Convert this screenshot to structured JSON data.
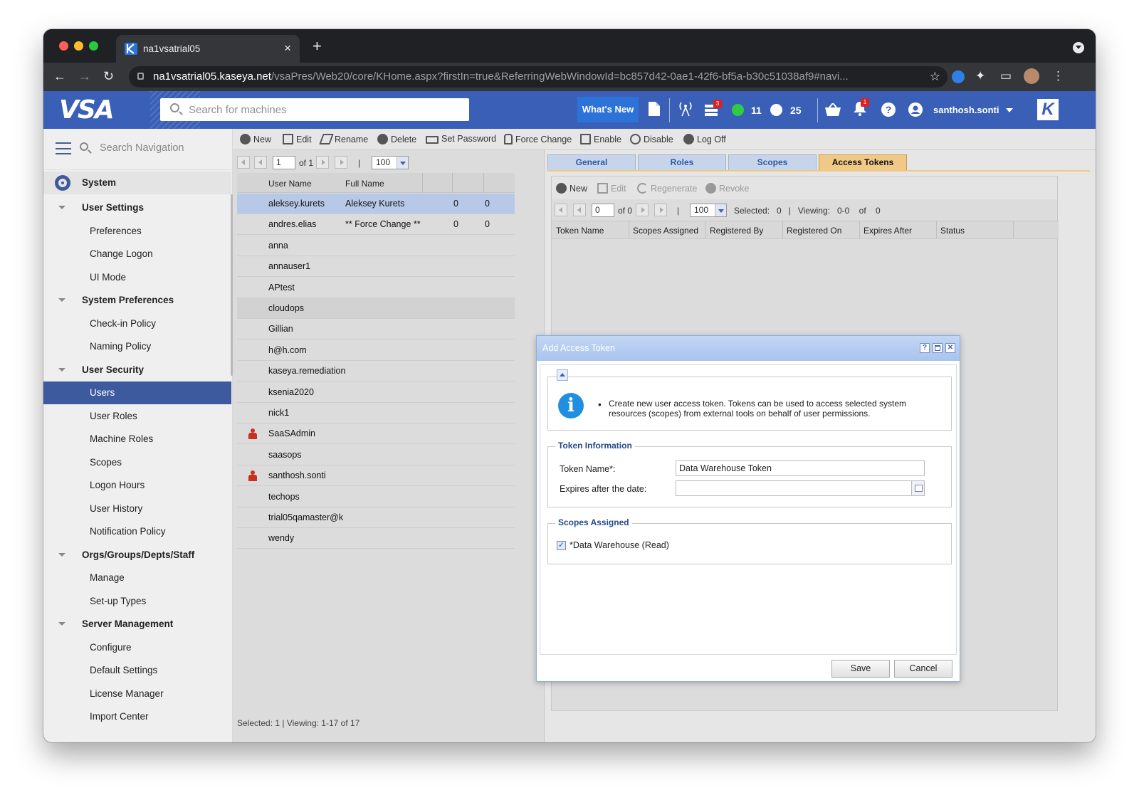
{
  "browser": {
    "tab_title": "na1vsatrial05",
    "new_tab_symbol": "+",
    "close_symbol": "×",
    "url_domain": "na1vsatrial05.kaseya.net",
    "url_path": "/vsaPres/Web20/core/KHome.aspx?firstIn=true&ReferringWebWindowId=bc857d42-0ae1-42f6-bf5a-b30c51038af9#navi..."
  },
  "header": {
    "logo": "VSA",
    "search_placeholder": "Search for machines",
    "whats_new": "What's New",
    "alerts_badge": "3",
    "online_count": "11",
    "offline_count": "25",
    "notif_badge": "1",
    "user": "santhosh.sonti",
    "brand_k": "K",
    "colors": {
      "header": "#3a5fb6",
      "online": "#2ecc40",
      "offline": "#ffffff"
    }
  },
  "sidebar": {
    "search_placeholder": "Search Navigation",
    "system": "System",
    "items": [
      {
        "label": "User Settings",
        "type": "grp"
      },
      {
        "label": "Preferences",
        "type": "item"
      },
      {
        "label": "Change Logon",
        "type": "item"
      },
      {
        "label": "UI Mode",
        "type": "item"
      },
      {
        "label": "System Preferences",
        "type": "grp"
      },
      {
        "label": "Check-in Policy",
        "type": "item"
      },
      {
        "label": "Naming Policy",
        "type": "item"
      },
      {
        "label": "User Security",
        "type": "grp"
      },
      {
        "label": "Users",
        "type": "sel"
      },
      {
        "label": "User Roles",
        "type": "item"
      },
      {
        "label": "Machine Roles",
        "type": "item"
      },
      {
        "label": "Scopes",
        "type": "item"
      },
      {
        "label": "Logon Hours",
        "type": "item"
      },
      {
        "label": "User History",
        "type": "item"
      },
      {
        "label": "Notification Policy",
        "type": "item"
      },
      {
        "label": "Orgs/Groups/Depts/Staff",
        "type": "grp"
      },
      {
        "label": "Manage",
        "type": "item"
      },
      {
        "label": "Set-up Types",
        "type": "item"
      },
      {
        "label": "Server Management",
        "type": "grp"
      },
      {
        "label": "Configure",
        "type": "item"
      },
      {
        "label": "Default Settings",
        "type": "item"
      },
      {
        "label": "License Manager",
        "type": "item"
      },
      {
        "label": "Import Center",
        "type": "item"
      }
    ]
  },
  "toolbar": {
    "new": "New",
    "edit": "Edit",
    "rename": "Rename",
    "delete": "Delete",
    "set_password": "Set Password",
    "force_change": "Force Change",
    "enable": "Enable",
    "disable": "Disable",
    "log_off": "Log Off"
  },
  "users_pager": {
    "page": "1",
    "of": "of 1",
    "sep": "|",
    "page_size": "100"
  },
  "users_grid": {
    "col_user": "User Name",
    "col_full": "Full Name",
    "rows": [
      {
        "user": "aleksey.kurets",
        "full": "Aleksey Kurets",
        "a": "0",
        "b": "0",
        "sel": true
      },
      {
        "user": "andres.elias",
        "full": "** Force Change **",
        "a": "0",
        "b": "0"
      },
      {
        "user": "anna",
        "full": "",
        "a": "",
        "b": ""
      },
      {
        "user": "annauser1",
        "full": "",
        "a": "",
        "b": ""
      },
      {
        "user": "APtest",
        "full": "",
        "a": "",
        "b": ""
      },
      {
        "user": "cloudops",
        "full": "",
        "a": "",
        "b": "",
        "alt": true
      },
      {
        "user": "Gillian",
        "full": "",
        "a": "",
        "b": ""
      },
      {
        "user": "h@h.com",
        "full": "",
        "a": "",
        "b": ""
      },
      {
        "user": "kaseya.remediation",
        "full": "",
        "a": "",
        "b": ""
      },
      {
        "user": "ksenia2020",
        "full": "",
        "a": "",
        "b": ""
      },
      {
        "user": "nick1",
        "full": "",
        "a": "",
        "b": ""
      },
      {
        "user": "SaaSAdmin",
        "full": "",
        "a": "",
        "b": "",
        "icon": true
      },
      {
        "user": "saasops",
        "full": "",
        "a": "",
        "b": ""
      },
      {
        "user": "santhosh.sonti",
        "full": "",
        "a": "",
        "b": "",
        "icon": true
      },
      {
        "user": "techops",
        "full": "",
        "a": "",
        "b": ""
      },
      {
        "user": "trial05qamaster@k",
        "full": "",
        "a": "",
        "b": ""
      },
      {
        "user": "wendy",
        "full": "",
        "a": "",
        "b": ""
      }
    ],
    "status": "Selected:   1   |   Viewing:   1-17    of    17"
  },
  "detail_tabs": [
    "General",
    "Roles",
    "Scopes",
    "Access Tokens"
  ],
  "tokens_toolbar": {
    "new": "New",
    "edit": "Edit",
    "regenerate": "Regenerate",
    "revoke": "Revoke"
  },
  "tokens_pager": {
    "page": "0",
    "of": "of 0",
    "sep": "|",
    "page_size": "100",
    "status": "Selected:   0   |   Viewing:   0-0    of    0"
  },
  "tokens_grid": {
    "cols": [
      "Token Name",
      "Scopes Assigned",
      "Registered By",
      "Registered On",
      "Expires After",
      "Status"
    ]
  },
  "modal": {
    "title": "Add Access Token",
    "help": "?",
    "info_text": "Create new user access token. Tokens can be used to access selected system resources (scopes) from external tools on behalf of user permissions.",
    "token_info_legend": "Token Information",
    "token_name_label": "Token Name*:",
    "token_name_value": "Data Warehouse Token",
    "expires_label": "Expires after the date:",
    "expires_value": "",
    "scopes_legend": "Scopes Assigned",
    "scope_item": "*Data Warehouse (Read)",
    "scope_checked": true,
    "save": "Save",
    "cancel": "Cancel"
  }
}
